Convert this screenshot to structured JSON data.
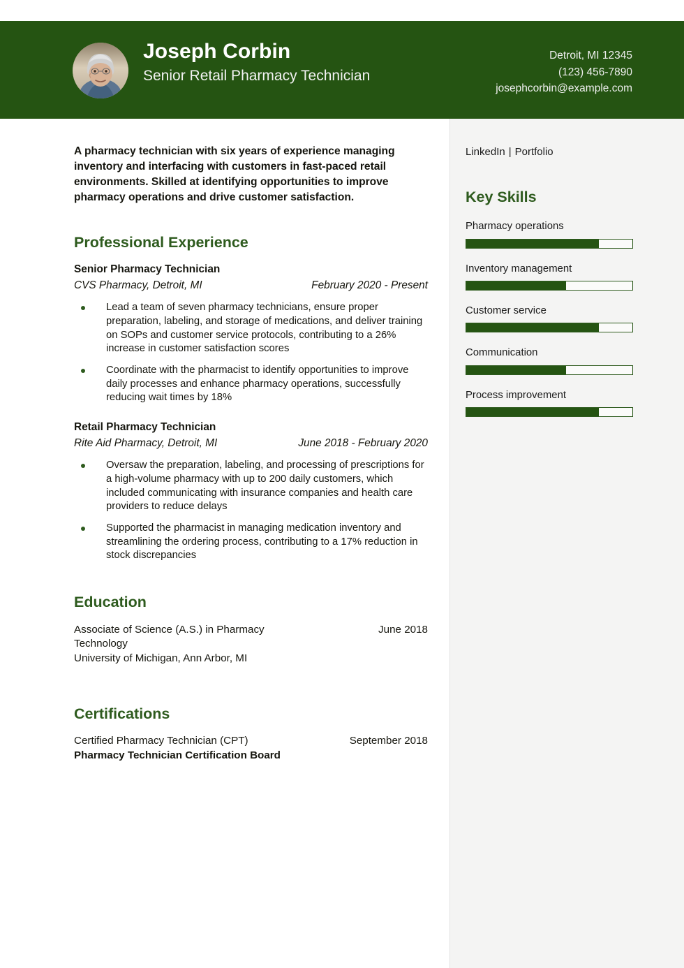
{
  "theme": {
    "header_bg": "#255412",
    "accent_green": "#2e5b1e",
    "sidebar_bg": "#f4f4f3",
    "main_bg": "#ffffff",
    "text": "#16160f"
  },
  "header": {
    "name": "Joseph Corbin",
    "job_title": "Senior Retail Pharmacy Technician",
    "avatar_alt": "profile-photo",
    "contact": {
      "location": "Detroit, MI 12345",
      "phone": "(123) 456-7890",
      "email": "josephcorbin@example.com"
    }
  },
  "main": {
    "summary": "A pharmacy technician with six years of experience managing inventory and interfacing with customers in fast-paced retail environments. Skilled at identifying opportunities to improve pharmacy operations and drive customer satisfaction.",
    "experience": {
      "heading": "Professional Experience",
      "jobs": [
        {
          "role": "Senior Pharmacy Technician",
          "org": "CVS Pharmacy, Detroit, MI",
          "dates": "February 2020 - Present",
          "bullets": [
            "Lead a team of seven pharmacy technicians, ensure proper preparation, labeling, and storage of medications, and deliver training on SOPs and customer service protocols, contributing to a 26% increase in customer satisfaction scores",
            "Coordinate with the pharmacist to identify opportunities to improve daily processes and enhance pharmacy operations, successfully reducing wait times by 18%"
          ]
        },
        {
          "role": "Retail Pharmacy Technician",
          "org": "Rite Aid Pharmacy, Detroit, MI",
          "dates": "June 2018 - February 2020",
          "bullets": [
            "Oversaw the preparation, labeling, and processing of prescriptions for a high-volume pharmacy with up to 200 daily customers, which included communicating with insurance companies and health care providers to reduce delays",
            "Supported the pharmacist in managing medication inventory and streamlining the ordering process, contributing to a 17% reduction in stock discrepancies"
          ]
        }
      ]
    },
    "education": {
      "heading": "Education",
      "entries": [
        {
          "degree": "Associate of Science (A.S.) in Pharmacy Technology",
          "school": "University of Michigan, Ann Arbor, MI",
          "date": "June 2018"
        }
      ]
    },
    "certifications": {
      "heading": "Certifications",
      "entries": [
        {
          "title": "Certified Pharmacy Technician (CPT)",
          "issuer": "Pharmacy Technician Certification Board",
          "date": "September 2018"
        }
      ]
    }
  },
  "sidebar": {
    "links": {
      "linkedin": "LinkedIn",
      "separator": "|",
      "portfolio": "Portfolio"
    },
    "skills": {
      "heading": "Key Skills",
      "items": [
        {
          "label": "Pharmacy operations",
          "level": 80
        },
        {
          "label": "Inventory management",
          "level": 60
        },
        {
          "label": "Customer service",
          "level": 80
        },
        {
          "label": "Communication",
          "level": 60
        },
        {
          "label": "Process improvement",
          "level": 80
        }
      ]
    }
  }
}
